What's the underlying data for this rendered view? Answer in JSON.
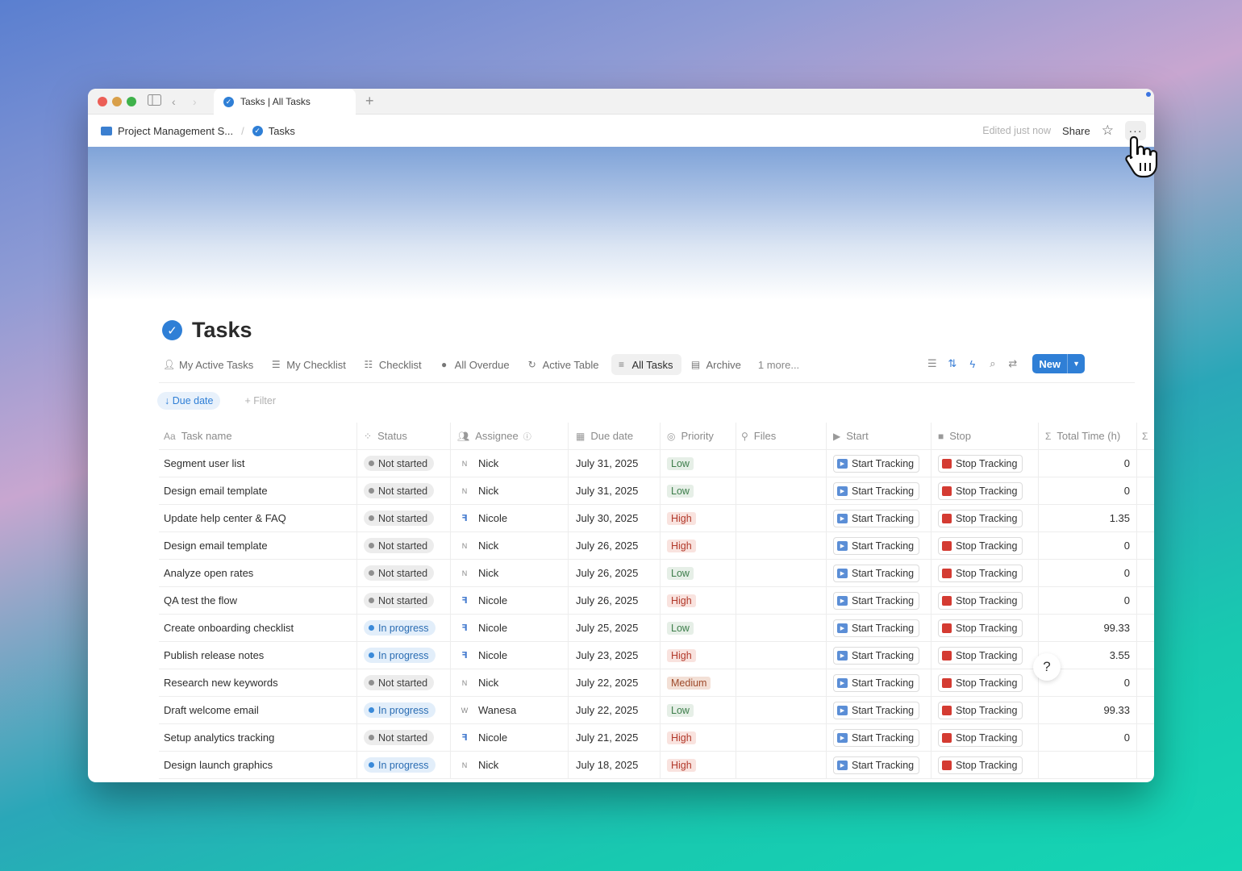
{
  "browser": {
    "tab_title": "Tasks | All Tasks",
    "new_tab": "+"
  },
  "breadcrumb": {
    "workspace": "Project Management S...",
    "page": "Tasks"
  },
  "topbar": {
    "edited": "Edited just now",
    "share": "Share",
    "more": "···"
  },
  "page": {
    "title": "Tasks"
  },
  "views": [
    {
      "label": "My Active Tasks",
      "icon": "person-icon"
    },
    {
      "label": "My Checklist",
      "icon": "list-icon"
    },
    {
      "label": "Checklist",
      "icon": "checklist-icon"
    },
    {
      "label": "All Overdue",
      "icon": "skull-icon"
    },
    {
      "label": "Active Table",
      "icon": "refresh-icon"
    },
    {
      "label": "All Tasks",
      "icon": "list-icon",
      "active": true
    },
    {
      "label": "Archive",
      "icon": "archive-icon"
    },
    {
      "label": "1 more..."
    }
  ],
  "toolbar": {
    "new_label": "New"
  },
  "filters": {
    "sort_chip": "↓ Due date",
    "add_filter": "+ Filter"
  },
  "columns": {
    "name": "Task name",
    "status": "Status",
    "assignee": "Assignee",
    "due": "Due date",
    "priority": "Priority",
    "files": "Files",
    "start": "Start",
    "stop": "Stop",
    "total": "Total Time (h)"
  },
  "rows": [
    {
      "name": "Segment user list",
      "status": "Not started",
      "assignee": "Nick",
      "avatar": "N",
      "due": "July 31, 2025",
      "priority": "Low",
      "start": "Start Tracking",
      "stop": "Stop Tracking",
      "total": "0"
    },
    {
      "name": "Design email template",
      "status": "Not started",
      "assignee": "Nick",
      "avatar": "N",
      "due": "July 31, 2025",
      "priority": "Low",
      "start": "Start Tracking",
      "stop": "Stop Tracking",
      "total": "0"
    },
    {
      "name": "Update help center & FAQ",
      "status": "Not started",
      "assignee": "Nicole",
      "avatar": "ꟻ",
      "due": "July 30, 2025",
      "priority": "High",
      "start": "Start Tracking",
      "stop": "Stop Tracking",
      "total": "1.35"
    },
    {
      "name": "Design email template",
      "status": "Not started",
      "assignee": "Nick",
      "avatar": "N",
      "due": "July 26, 2025",
      "priority": "High",
      "start": "Start Tracking",
      "stop": "Stop Tracking",
      "total": "0"
    },
    {
      "name": "Analyze open rates",
      "status": "Not started",
      "assignee": "Nick",
      "avatar": "N",
      "due": "July 26, 2025",
      "priority": "Low",
      "start": "Start Tracking",
      "stop": "Stop Tracking",
      "total": "0"
    },
    {
      "name": "QA test the flow",
      "status": "Not started",
      "assignee": "Nicole",
      "avatar": "ꟻ",
      "due": "July 26, 2025",
      "priority": "High",
      "start": "Start Tracking",
      "stop": "Stop Tracking",
      "total": "0"
    },
    {
      "name": "Create onboarding checklist",
      "status": "In progress",
      "assignee": "Nicole",
      "avatar": "ꟻ",
      "due": "July 25, 2025",
      "priority": "Low",
      "start": "Start Tracking",
      "stop": "Stop Tracking",
      "total": "99.33"
    },
    {
      "name": "Publish release notes",
      "status": "In progress",
      "assignee": "Nicole",
      "avatar": "ꟻ",
      "due": "July 23, 2025",
      "priority": "High",
      "start": "Start Tracking",
      "stop": "Stop Tracking",
      "total": "3.55"
    },
    {
      "name": "Research new keywords",
      "status": "Not started",
      "assignee": "Nick",
      "avatar": "N",
      "due": "July 22, 2025",
      "priority": "Medium",
      "start": "Start Tracking",
      "stop": "Stop Tracking",
      "total": "0"
    },
    {
      "name": "Draft welcome email",
      "status": "In progress",
      "assignee": "Wanesa",
      "avatar": "W",
      "due": "July 22, 2025",
      "priority": "Low",
      "start": "Start Tracking",
      "stop": "Stop Tracking",
      "total": "99.33"
    },
    {
      "name": "Setup analytics tracking",
      "status": "Not started",
      "assignee": "Nicole",
      "avatar": "ꟻ",
      "due": "July 21, 2025",
      "priority": "High",
      "start": "Start Tracking",
      "stop": "Stop Tracking",
      "total": "0"
    },
    {
      "name": "Design launch graphics",
      "status": "In progress",
      "assignee": "Nick",
      "avatar": "N",
      "due": "July 18, 2025",
      "priority": "High",
      "start": "Start Tracking",
      "stop": "Stop Tracking",
      "total": ""
    }
  ],
  "colors": {
    "accent": "#2f7fd6",
    "not_started": "#ececec",
    "in_progress": "#e2eefa",
    "priority_low": "#e6efe7",
    "priority_high": "#f9e3df",
    "priority_medium": "#f3e0d6",
    "stop_red": "#d43b32"
  }
}
